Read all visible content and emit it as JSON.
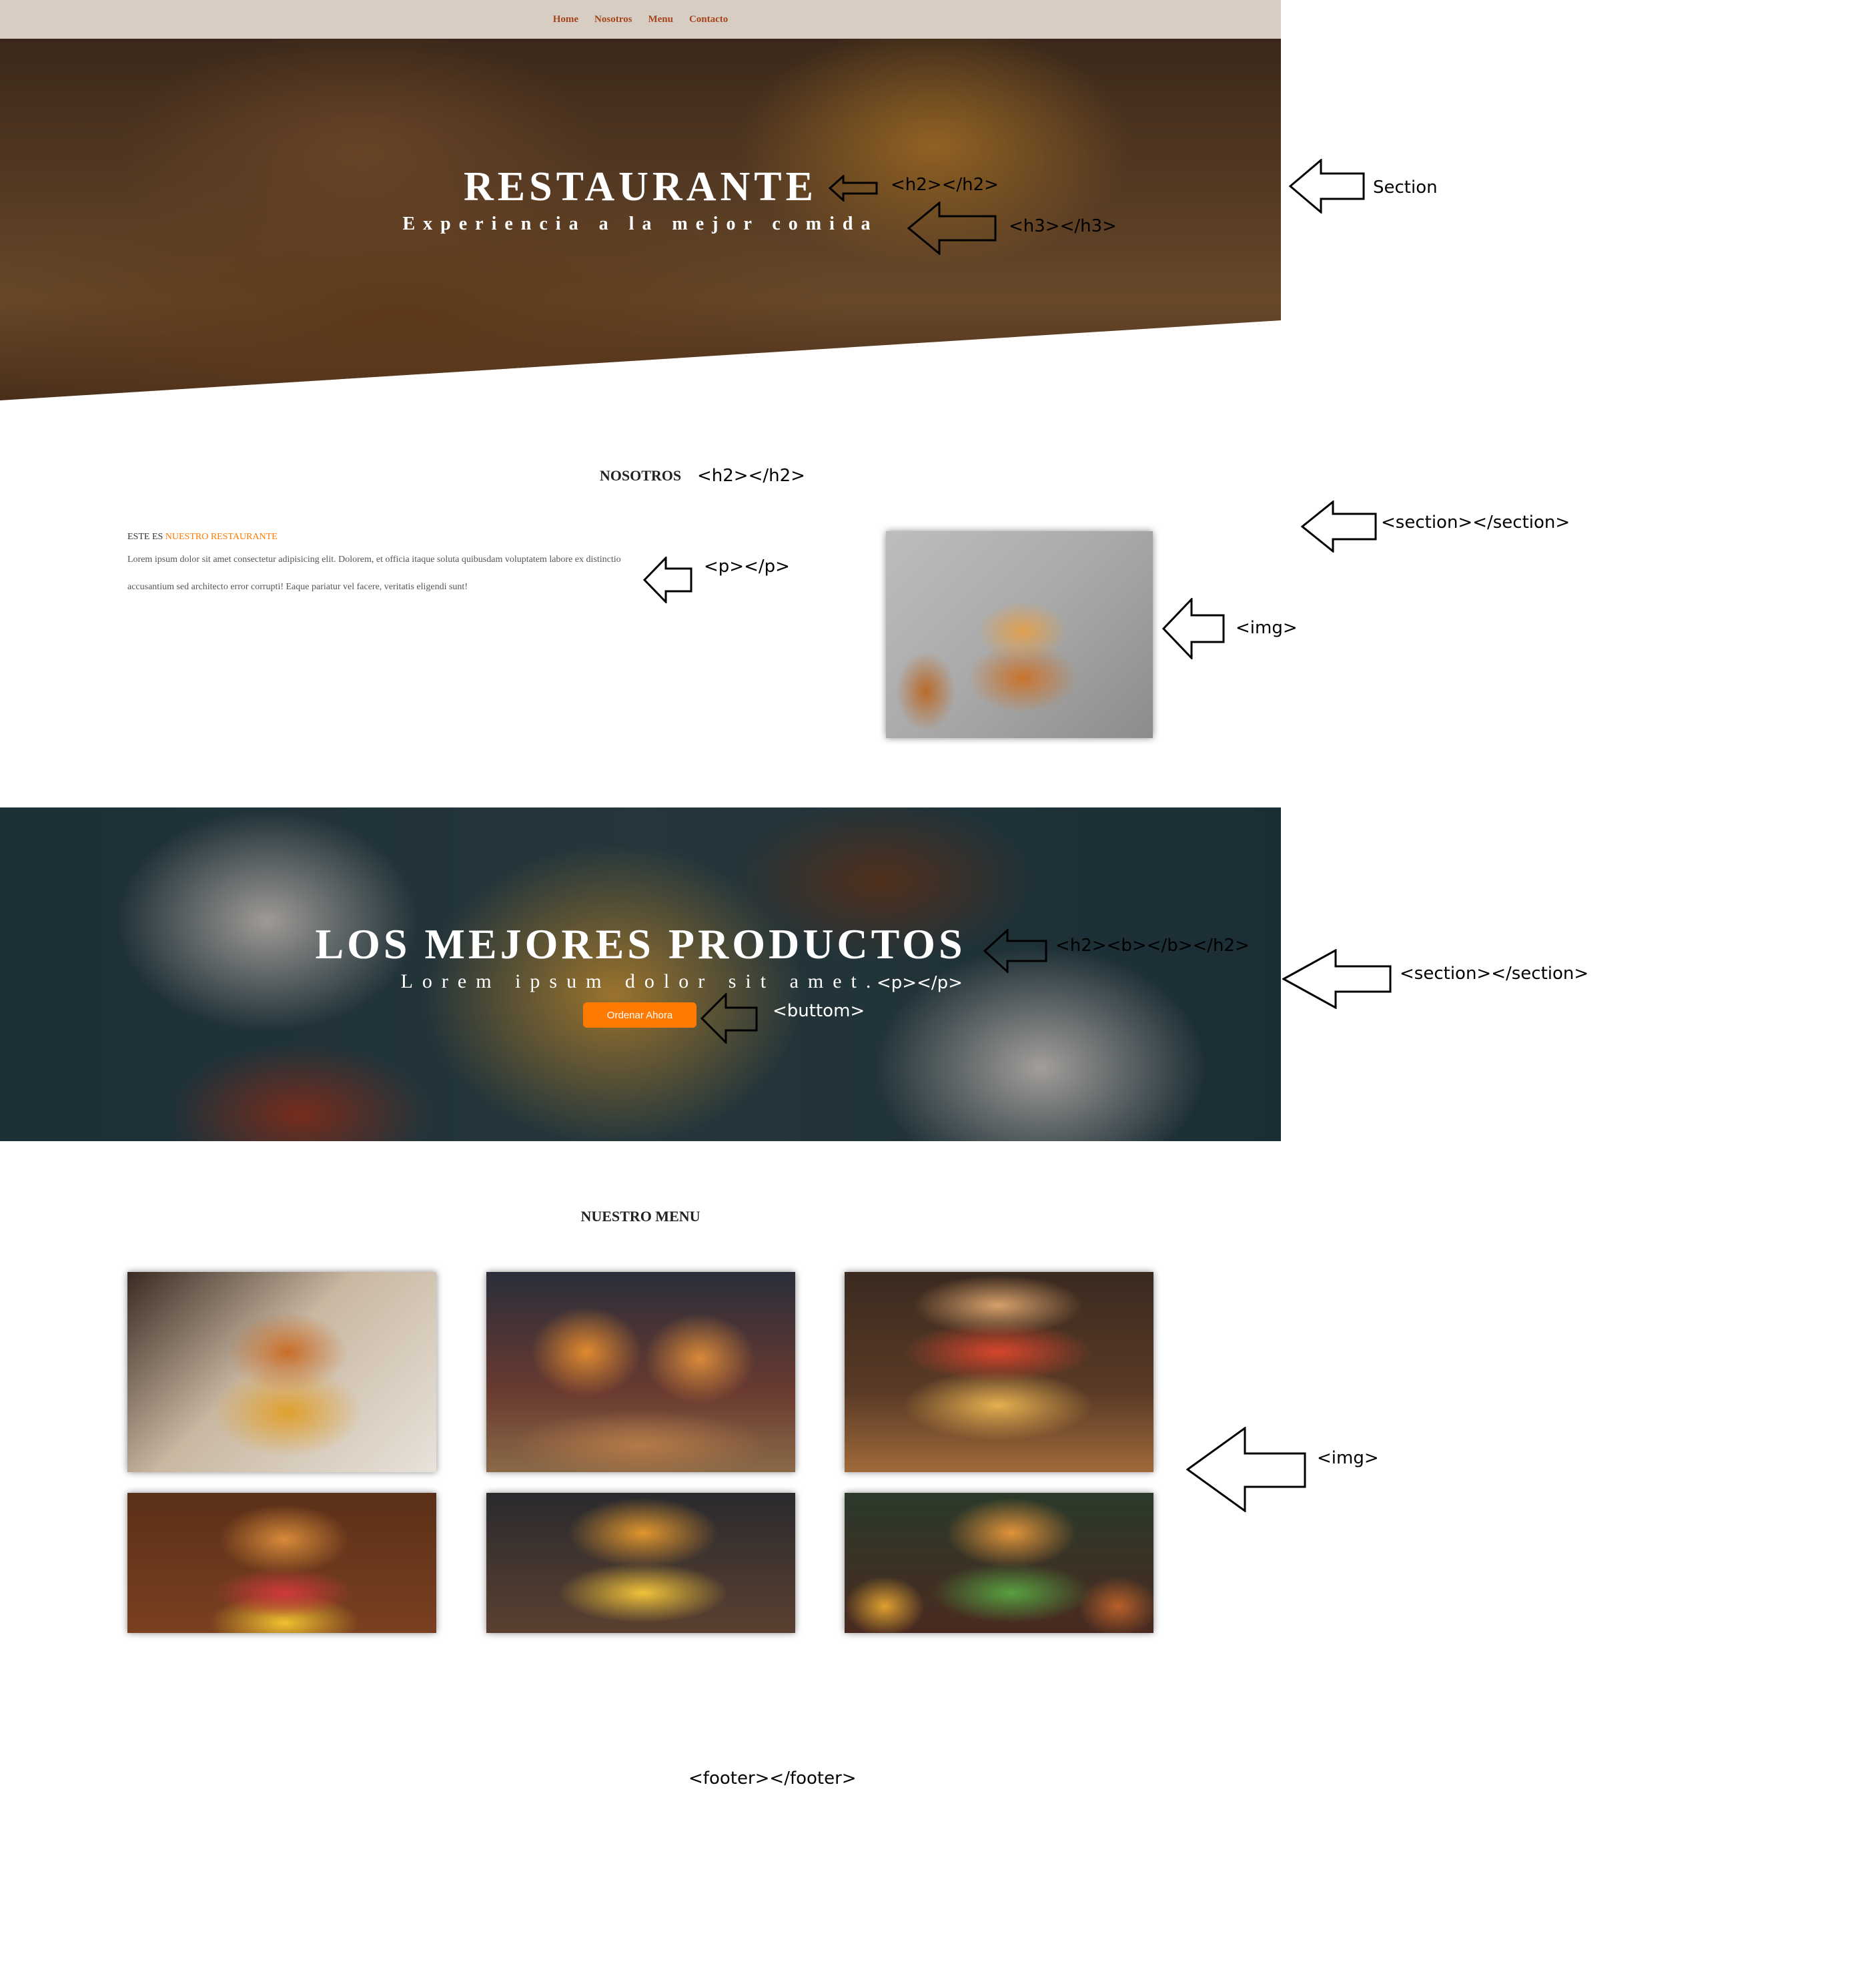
{
  "nav": {
    "items": [
      "Home",
      "Nosotros",
      "Menu",
      "Contacto"
    ]
  },
  "hero": {
    "title": "RESTAURANTE",
    "subtitle": "Experiencia a la mejor comida"
  },
  "about": {
    "title": "NOSOTROS",
    "kicker_prefix": "ESTE ES",
    "kicker_highlight": "NUESTRO RESTAURANTE",
    "paragraph": "Lorem ipsum dolor sit amet consectetur adipisicing elit. Dolorem, et officia itaque soluta quibusdam voluptatem labore ex distinctio accusantium sed architecto error corrupti! Eaque pariatur vel facere, veritatis eligendi sunt!"
  },
  "products": {
    "title": "LOS MEJORES PRODUCTOS",
    "subtitle": "Lorem ipsum dolor sit amet.",
    "button_label": "Ordenar Ahora"
  },
  "menu": {
    "title": "NUESTRO MENU"
  },
  "annotations": {
    "hero_h2": "<h2></h2>",
    "hero_h3": "<h3></h3>",
    "hero_section": "Section",
    "about_h2": "<h2></h2>",
    "about_section": "<section></section>",
    "about_p": "<p></p>",
    "about_img": "<img>",
    "products_h2": "<h2><b></b></h2>",
    "products_p": "<p></p>",
    "products_button": "<buttom>",
    "products_section": "<section></section>",
    "menu_img": "<img>",
    "footer": "<footer></footer>"
  },
  "colors": {
    "accent": "#ff7a00",
    "nav_text": "#a5441c",
    "nav_bg": "#d8cdc3"
  }
}
